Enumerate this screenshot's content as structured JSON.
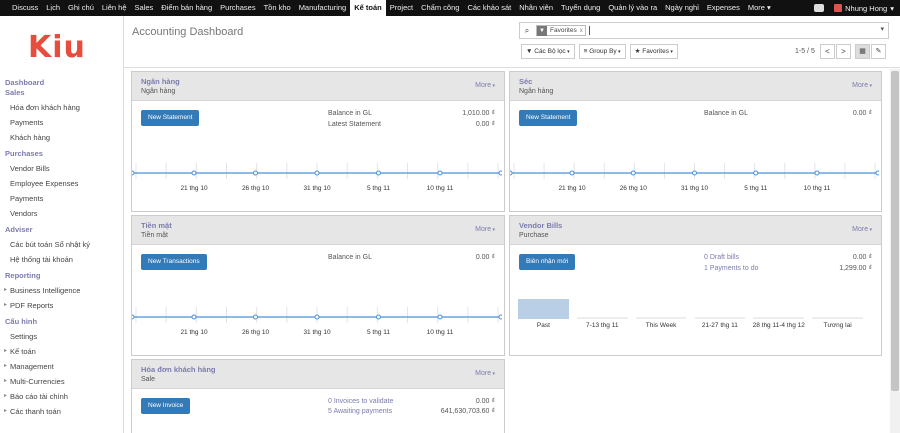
{
  "topnav": {
    "items": [
      "Discuss",
      "Lịch",
      "Ghi chú",
      "Liên hệ",
      "Sales",
      "Điểm bán hàng",
      "Purchases",
      "Tồn kho",
      "Manufacturing",
      "Kế toán",
      "Project",
      "Chấm công",
      "Các khảo sát",
      "Nhân viên",
      "Tuyển dụng",
      "Quản lý vào ra",
      "Ngày nghỉ",
      "Expenses",
      "More"
    ],
    "active_index": 9,
    "user": "Nhung Hong"
  },
  "logo": "Kiu",
  "sidebar": {
    "sections": [
      {
        "title": "Dashboard",
        "items": []
      },
      {
        "title": "Sales",
        "items": [
          {
            "label": "Hóa đơn khách hàng"
          },
          {
            "label": "Payments"
          },
          {
            "label": "Khách hàng"
          }
        ]
      },
      {
        "title": "Purchases",
        "items": [
          {
            "label": "Vendor Bills"
          },
          {
            "label": "Employee Expenses"
          },
          {
            "label": "Payments"
          },
          {
            "label": "Vendors"
          }
        ]
      },
      {
        "title": "Adviser",
        "items": [
          {
            "label": "Các bút toán Sổ nhật ký"
          },
          {
            "label": "Hệ thống tài khoản"
          }
        ]
      },
      {
        "title": "Reporting",
        "items": [
          {
            "label": "Business Intelligence",
            "caret": true
          },
          {
            "label": "PDF Reports",
            "caret": true
          }
        ]
      },
      {
        "title": "Cấu hình",
        "items": [
          {
            "label": "Settings"
          },
          {
            "label": "Kế toán",
            "caret": true
          },
          {
            "label": "Management",
            "caret": true
          },
          {
            "label": "Multi-Currencies",
            "caret": true
          },
          {
            "label": "Báo cáo tài chính",
            "caret": true
          },
          {
            "label": "Các thanh toán",
            "caret": true
          }
        ]
      }
    ]
  },
  "header": {
    "title": "Accounting Dashboard",
    "facet_label": "Favorites",
    "facet_close": "x",
    "filters_label": "Các Bộ lọc",
    "groupby_label": "Group By",
    "favorites_label": "Favorites",
    "pager": "1-5 / 5",
    "prev": "<",
    "next": ">"
  },
  "cards": {
    "bank": {
      "title": "Ngân hàng",
      "subtitle": "Ngân hàng",
      "more": "More",
      "button": "New Statement",
      "rows": [
        {
          "label": "Balance in GL",
          "value": "1,010.00 ₫"
        },
        {
          "label": "Latest Statement",
          "value": "0.00 ₫"
        }
      ],
      "ticks": [
        "21 thg 10",
        "26 thg 10",
        "31 thg 10",
        "5 thg 11",
        "10 thg 11"
      ]
    },
    "cheque": {
      "title": "Séc",
      "subtitle": "Ngân hàng",
      "more": "More",
      "button": "New Statement",
      "rows": [
        {
          "label": "Balance in GL",
          "value": "0.00 ₫"
        }
      ],
      "ticks": [
        "21 thg 10",
        "26 thg 10",
        "31 thg 10",
        "5 thg 11",
        "10 thg 11"
      ]
    },
    "cash": {
      "title": "Tiền mặt",
      "subtitle": "Tiền mặt",
      "more": "More",
      "button": "New Transactions",
      "rows": [
        {
          "label": "Balance in GL",
          "value": "0.00 ₫"
        }
      ],
      "ticks": [
        "21 thg 10",
        "26 thg 10",
        "31 thg 10",
        "5 thg 11",
        "10 thg 11"
      ]
    },
    "vendor": {
      "title": "Vendor Bills",
      "subtitle": "Purchase",
      "more": "More",
      "button": "Biên nhận mới",
      "rows": [
        {
          "label": "0 Draft bills",
          "value": "0.00 ₫"
        },
        {
          "label": "1 Payments to do",
          "value": "1,299.00 ₫"
        }
      ],
      "bars": [
        "Past",
        "7-13 thg 11",
        "This Week",
        "21-27 thg 11",
        "28 thg 11-4 thg 12",
        "Tương lai"
      ]
    },
    "invoice": {
      "title": "Hóa đơn khách hàng",
      "subtitle": "Sale",
      "more": "More",
      "button": "New Invoice",
      "rows": [
        {
          "label": "0 Invoices to validate",
          "value": "0.00 ₫"
        },
        {
          "label": "5 Awaiting payments",
          "value": "641,630,703.60 ₫"
        }
      ]
    }
  },
  "chart_data": [
    {
      "type": "line",
      "title": "",
      "categories": [
        "21 thg 10",
        "26 thg 10",
        "31 thg 10",
        "5 thg 11",
        "10 thg 11"
      ],
      "values": [
        0,
        0,
        0,
        0,
        0
      ]
    },
    {
      "type": "line",
      "title": "",
      "categories": [
        "21 thg 10",
        "26 thg 10",
        "31 thg 10",
        "5 thg 11",
        "10 thg 11"
      ],
      "values": [
        0,
        0,
        0,
        0,
        0
      ]
    },
    {
      "type": "line",
      "title": "",
      "categories": [
        "21 thg 10",
        "26 thg 10",
        "31 thg 10",
        "5 thg 11",
        "10 thg 11"
      ],
      "values": [
        0,
        0,
        0,
        0,
        0
      ]
    },
    {
      "type": "bar",
      "title": "",
      "categories": [
        "Past",
        "7-13 thg 11",
        "This Week",
        "21-27 thg 11",
        "28 thg 11-4 thg 12",
        "Tương lai"
      ],
      "values": [
        1299,
        0,
        0,
        0,
        0,
        0
      ]
    }
  ],
  "colors": {
    "accent": "#7c7bad",
    "button": "#337ab7",
    "line": "#4a90d9",
    "logo": "#e74c3c"
  }
}
